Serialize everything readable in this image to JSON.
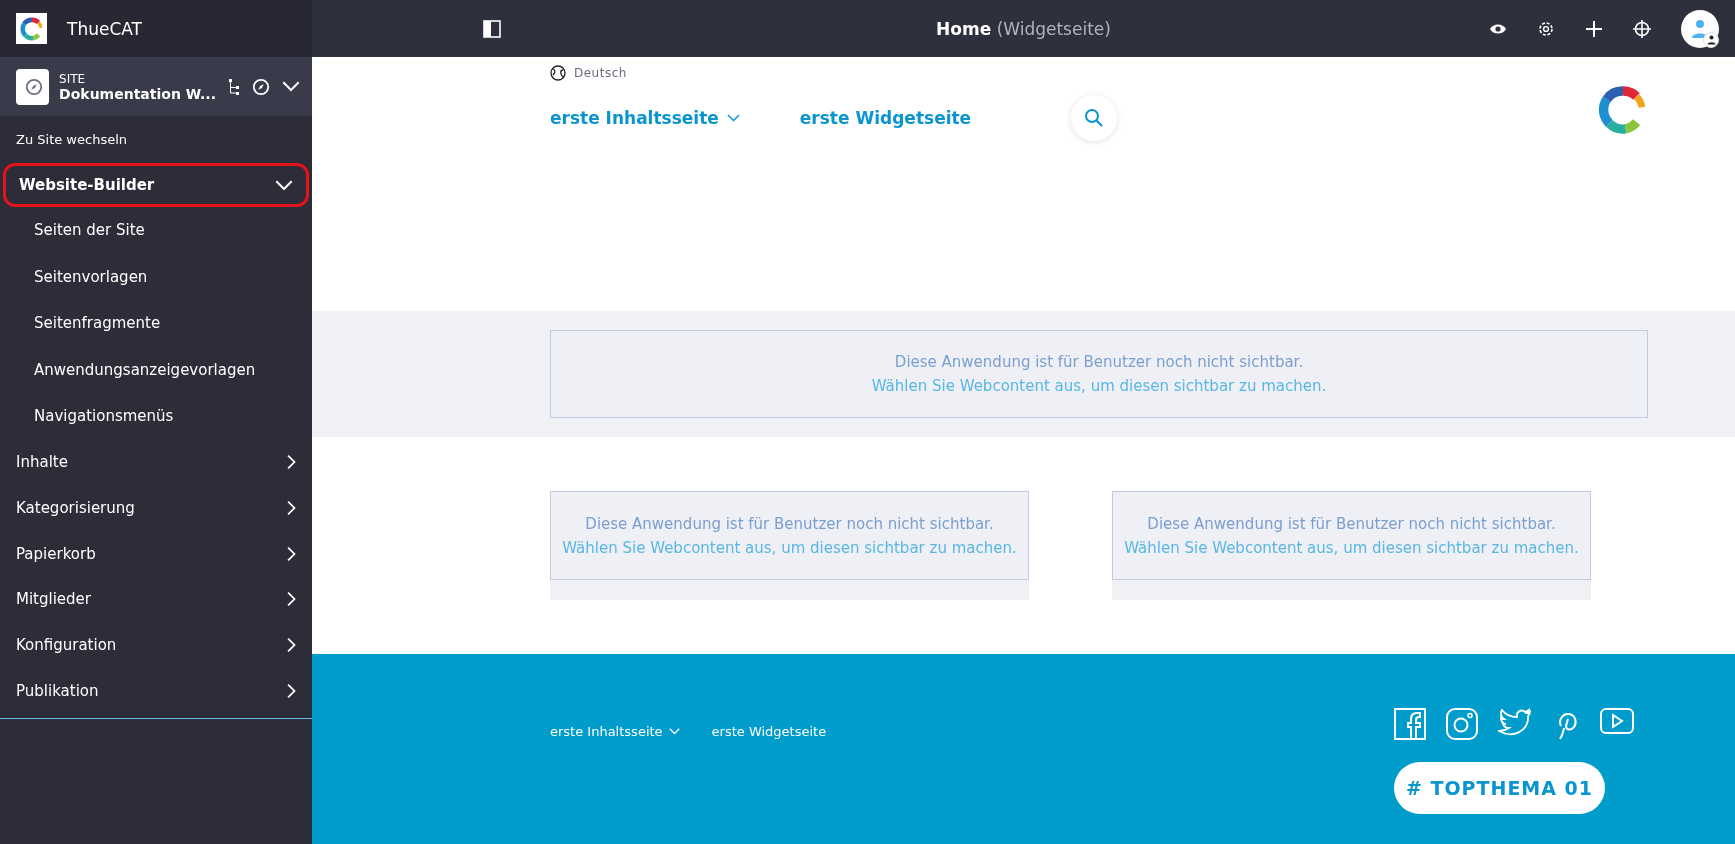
{
  "sidebar": {
    "brand": "ThueCAT",
    "site": {
      "label": "SITE",
      "name": "Dokumentation W..."
    },
    "switch_site": "Zu Site wechseln",
    "sections": [
      {
        "label": "Website-Builder",
        "expanded": true,
        "highlighted": true,
        "children": [
          {
            "label": "Seiten der Site"
          },
          {
            "label": "Seitenvorlagen"
          },
          {
            "label": "Seitenfragmente"
          },
          {
            "label": "Anwendungsanzeigevorlagen"
          },
          {
            "label": "Navigationsmenüs"
          }
        ]
      },
      {
        "label": "Inhalte",
        "expanded": false,
        "highlighted": false
      },
      {
        "label": "Kategorisierung",
        "expanded": false,
        "highlighted": false
      },
      {
        "label": "Papierkorb",
        "expanded": false,
        "highlighted": false
      },
      {
        "label": "Mitglieder",
        "expanded": false,
        "highlighted": false
      },
      {
        "label": "Konfiguration",
        "expanded": false,
        "highlighted": false
      },
      {
        "label": "Publikation",
        "expanded": false,
        "highlighted": false
      }
    ]
  },
  "topbar": {
    "title": "Home",
    "subtitle": "(Widgetseite)"
  },
  "page": {
    "language": "Deutsch",
    "nav": [
      {
        "label": "erste Inhaltsseite",
        "dropdown": true
      },
      {
        "label": "erste Widgetseite",
        "dropdown": false
      }
    ],
    "notice_wide": {
      "line1": "Diese Anwendung ist für Benutzer noch nicht sichtbar.",
      "line2": "Wählen Sie Webcontent aus, um diesen sichtbar zu machen."
    },
    "notices": [
      {
        "line1": "Diese Anwendung ist für Benutzer noch nicht sichtbar.",
        "line2": "Wählen Sie Webcontent aus, um diesen sichtbar zu machen."
      },
      {
        "line1": "Diese Anwendung ist für Benutzer noch nicht sichtbar.",
        "line2": "Wählen Sie Webcontent aus, um diesen sichtbar zu machen."
      }
    ]
  },
  "footer": {
    "nav": [
      {
        "label": "erste Inhaltsseite",
        "dropdown": true
      },
      {
        "label": "erste Widgetseite",
        "dropdown": false
      }
    ],
    "button": "# TOPTHEMA 01"
  }
}
